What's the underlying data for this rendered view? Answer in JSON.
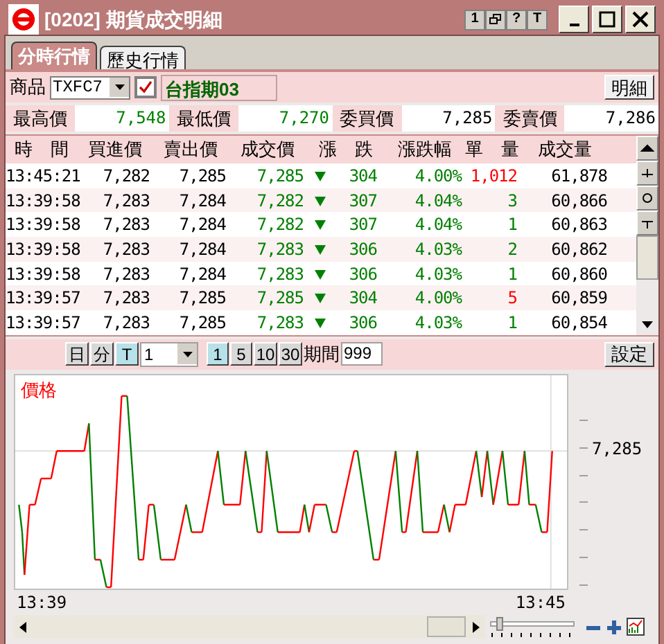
{
  "window": {
    "title": "[0202] 期貨成交明細",
    "title_buttons": [
      "1",
      "?",
      "T"
    ]
  },
  "tabs": [
    {
      "label": "分時行情",
      "selected": true
    },
    {
      "label": "歷史行情",
      "selected": false
    }
  ],
  "product": {
    "label": "商品",
    "code": "TXFC7",
    "checked": true,
    "name": "台指期03",
    "detail_button": "明細"
  },
  "stats": [
    {
      "label": "最高價",
      "value": "7,548",
      "color": "#008000"
    },
    {
      "label": "最低價",
      "value": "7,270",
      "color": "#008000"
    },
    {
      "label": "委買價",
      "value": "7,285",
      "color": "#000000"
    },
    {
      "label": "委賣價",
      "value": "7,286",
      "color": "#000000"
    }
  ],
  "table": {
    "columns": [
      "時　間",
      "買進價",
      "賣出價",
      "成交價",
      "漲　跌",
      "漲跌幅",
      "單　量",
      "成交量"
    ],
    "rows": [
      {
        "time": "13:45:21",
        "bid": "7,282",
        "ask": "7,285",
        "price": "7,285",
        "change": "304",
        "pct": "4.00%",
        "qty": "1,012",
        "qty_up": true,
        "volume": "61,878"
      },
      {
        "time": "13:39:58",
        "bid": "7,283",
        "ask": "7,284",
        "price": "7,282",
        "change": "307",
        "pct": "4.04%",
        "qty": "3",
        "qty_up": false,
        "volume": "60,866"
      },
      {
        "time": "13:39:58",
        "bid": "7,283",
        "ask": "7,284",
        "price": "7,282",
        "change": "307",
        "pct": "4.04%",
        "qty": "1",
        "qty_up": false,
        "volume": "60,863"
      },
      {
        "time": "13:39:58",
        "bid": "7,283",
        "ask": "7,284",
        "price": "7,283",
        "change": "306",
        "pct": "4.03%",
        "qty": "2",
        "qty_up": false,
        "volume": "60,862"
      },
      {
        "time": "13:39:58",
        "bid": "7,283",
        "ask": "7,284",
        "price": "7,283",
        "change": "306",
        "pct": "4.03%",
        "qty": "1",
        "qty_up": false,
        "volume": "60,860"
      },
      {
        "time": "13:39:57",
        "bid": "7,283",
        "ask": "7,285",
        "price": "7,285",
        "change": "304",
        "pct": "4.00%",
        "qty": "5",
        "qty_up": true,
        "volume": "60,859"
      },
      {
        "time": "13:39:57",
        "bid": "7,283",
        "ask": "7,285",
        "price": "7,283",
        "change": "306",
        "pct": "4.03%",
        "qty": "1",
        "qty_up": false,
        "volume": "60,854"
      }
    ]
  },
  "toolbar": {
    "periods": [
      {
        "label": "日",
        "selected": false
      },
      {
        "label": "分",
        "selected": false
      },
      {
        "label": "T",
        "selected": true
      }
    ],
    "interval": "1",
    "steps": [
      {
        "label": "1",
        "selected": true
      },
      {
        "label": "5",
        "selected": false
      },
      {
        "label": "10",
        "selected": false
      },
      {
        "label": "30",
        "selected": false
      }
    ],
    "period_label": "期間",
    "period_value": "999",
    "settings_button": "設定"
  },
  "zoom_slider": {
    "level": 0.08
  },
  "chart": {
    "title": "價格",
    "y_label": "7,285",
    "x_start": "13:39",
    "x_end": "13:45"
  }
}
